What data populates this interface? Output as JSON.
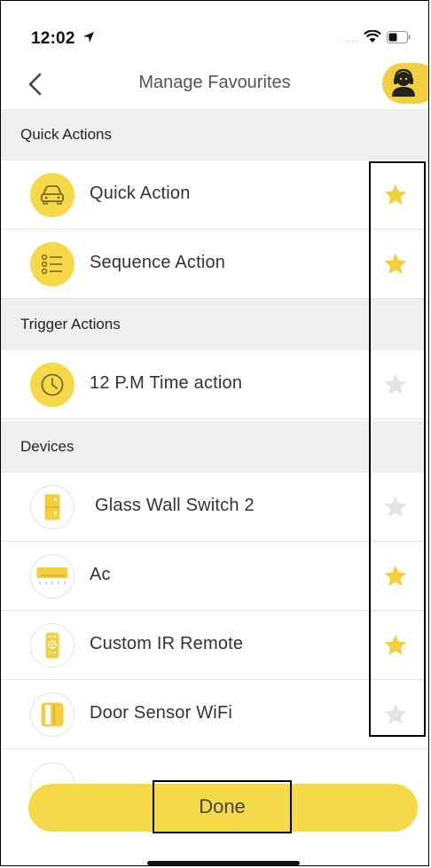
{
  "status_bar": {
    "time": "12:02"
  },
  "header": {
    "title": "Manage Favourites"
  },
  "sections": [
    {
      "title": "Quick Actions",
      "items": [
        {
          "label": "Quick Action",
          "icon": "car-icon",
          "favourite": true
        },
        {
          "label": "Sequence Action",
          "icon": "list-icon",
          "favourite": true
        }
      ]
    },
    {
      "title": "Trigger Actions",
      "items": [
        {
          "label": "12 P.M Time action",
          "icon": "clock-icon",
          "favourite": false
        }
      ]
    },
    {
      "title": "Devices",
      "items": [
        {
          "label": "Glass Wall Switch 2",
          "icon": "wall-switch-icon",
          "favourite": false
        },
        {
          "label": "Ac",
          "icon": "air-conditioner-icon",
          "favourite": true
        },
        {
          "label": "Custom IR Remote",
          "icon": "remote-icon",
          "favourite": true
        },
        {
          "label": "Door Sensor WiFi",
          "icon": "door-sensor-icon",
          "favourite": false
        }
      ]
    }
  ],
  "footer": {
    "done_label": "Done"
  },
  "colors": {
    "accent": "#f5d949",
    "star_on": "#f2cf3c",
    "star_off": "#e3e3e3",
    "section_bg": "#efefef"
  }
}
